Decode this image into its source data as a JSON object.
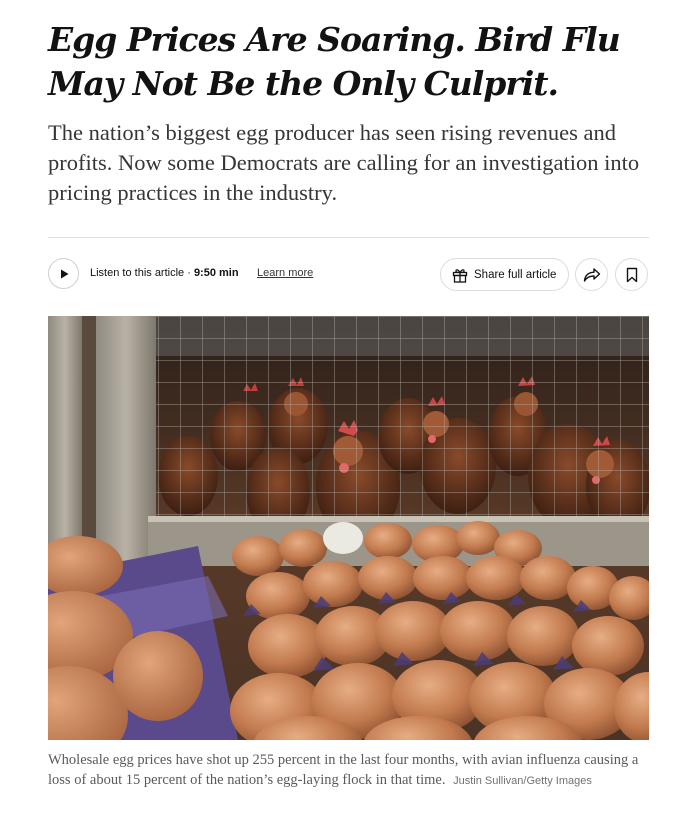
{
  "article": {
    "headline": "Egg Prices Are Soaring. Bird Flu May Not Be the Only Culprit.",
    "summary": "The nation’s biggest egg producer has seen rising revenues and profits. Now some Democrats are calling for an investigation into pricing practices in the industry."
  },
  "toolbar": {
    "listen_label": "Listen to this article · ",
    "duration": "9:50 min",
    "learn_more": "Learn more",
    "share_label": "Share full article",
    "icons": {
      "play": "play-icon",
      "gift": "gift-icon",
      "share": "share-arrow-icon",
      "save": "bookmark-icon"
    }
  },
  "photo": {
    "caption": "Wholesale egg prices have shot up 255 percent in the last four months, with avian influenza causing a loss of about 15 percent of the nation’s egg-laying flock in that time.",
    "credit": "Justin Sullivan/Getty Images"
  },
  "colors": {
    "text": "#121212",
    "summary_text": "#363636",
    "caption_text": "#5a5a5a",
    "rule": "#dfdfdf"
  }
}
